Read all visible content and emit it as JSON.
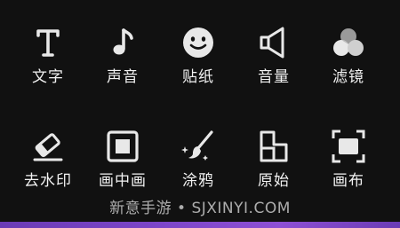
{
  "tools": {
    "text": {
      "label": "文字",
      "icon": "text-icon"
    },
    "audio": {
      "label": "声音",
      "icon": "music-note-icon"
    },
    "sticker": {
      "label": "贴纸",
      "icon": "smiley-icon"
    },
    "volume": {
      "label": "音量",
      "icon": "speaker-icon"
    },
    "filter": {
      "label": "滤镜",
      "icon": "filter-circles-icon"
    },
    "remove_watermark": {
      "label": "去水印",
      "icon": "eraser-icon"
    },
    "pip": {
      "label": "画中画",
      "icon": "picture-in-picture-icon"
    },
    "doodle": {
      "label": "涂鸦",
      "icon": "brush-icon"
    },
    "original": {
      "label": "原始",
      "icon": "original-ratio-icon"
    },
    "canvas": {
      "label": "画布",
      "icon": "canvas-frame-icon"
    }
  },
  "watermark": {
    "text": "新意手游 • SJXINYI.COM"
  },
  "colors": {
    "background": "#111111",
    "icon": "#e8e8e8",
    "label": "#f2f2f2",
    "accent_bar": "#7c45c9"
  }
}
